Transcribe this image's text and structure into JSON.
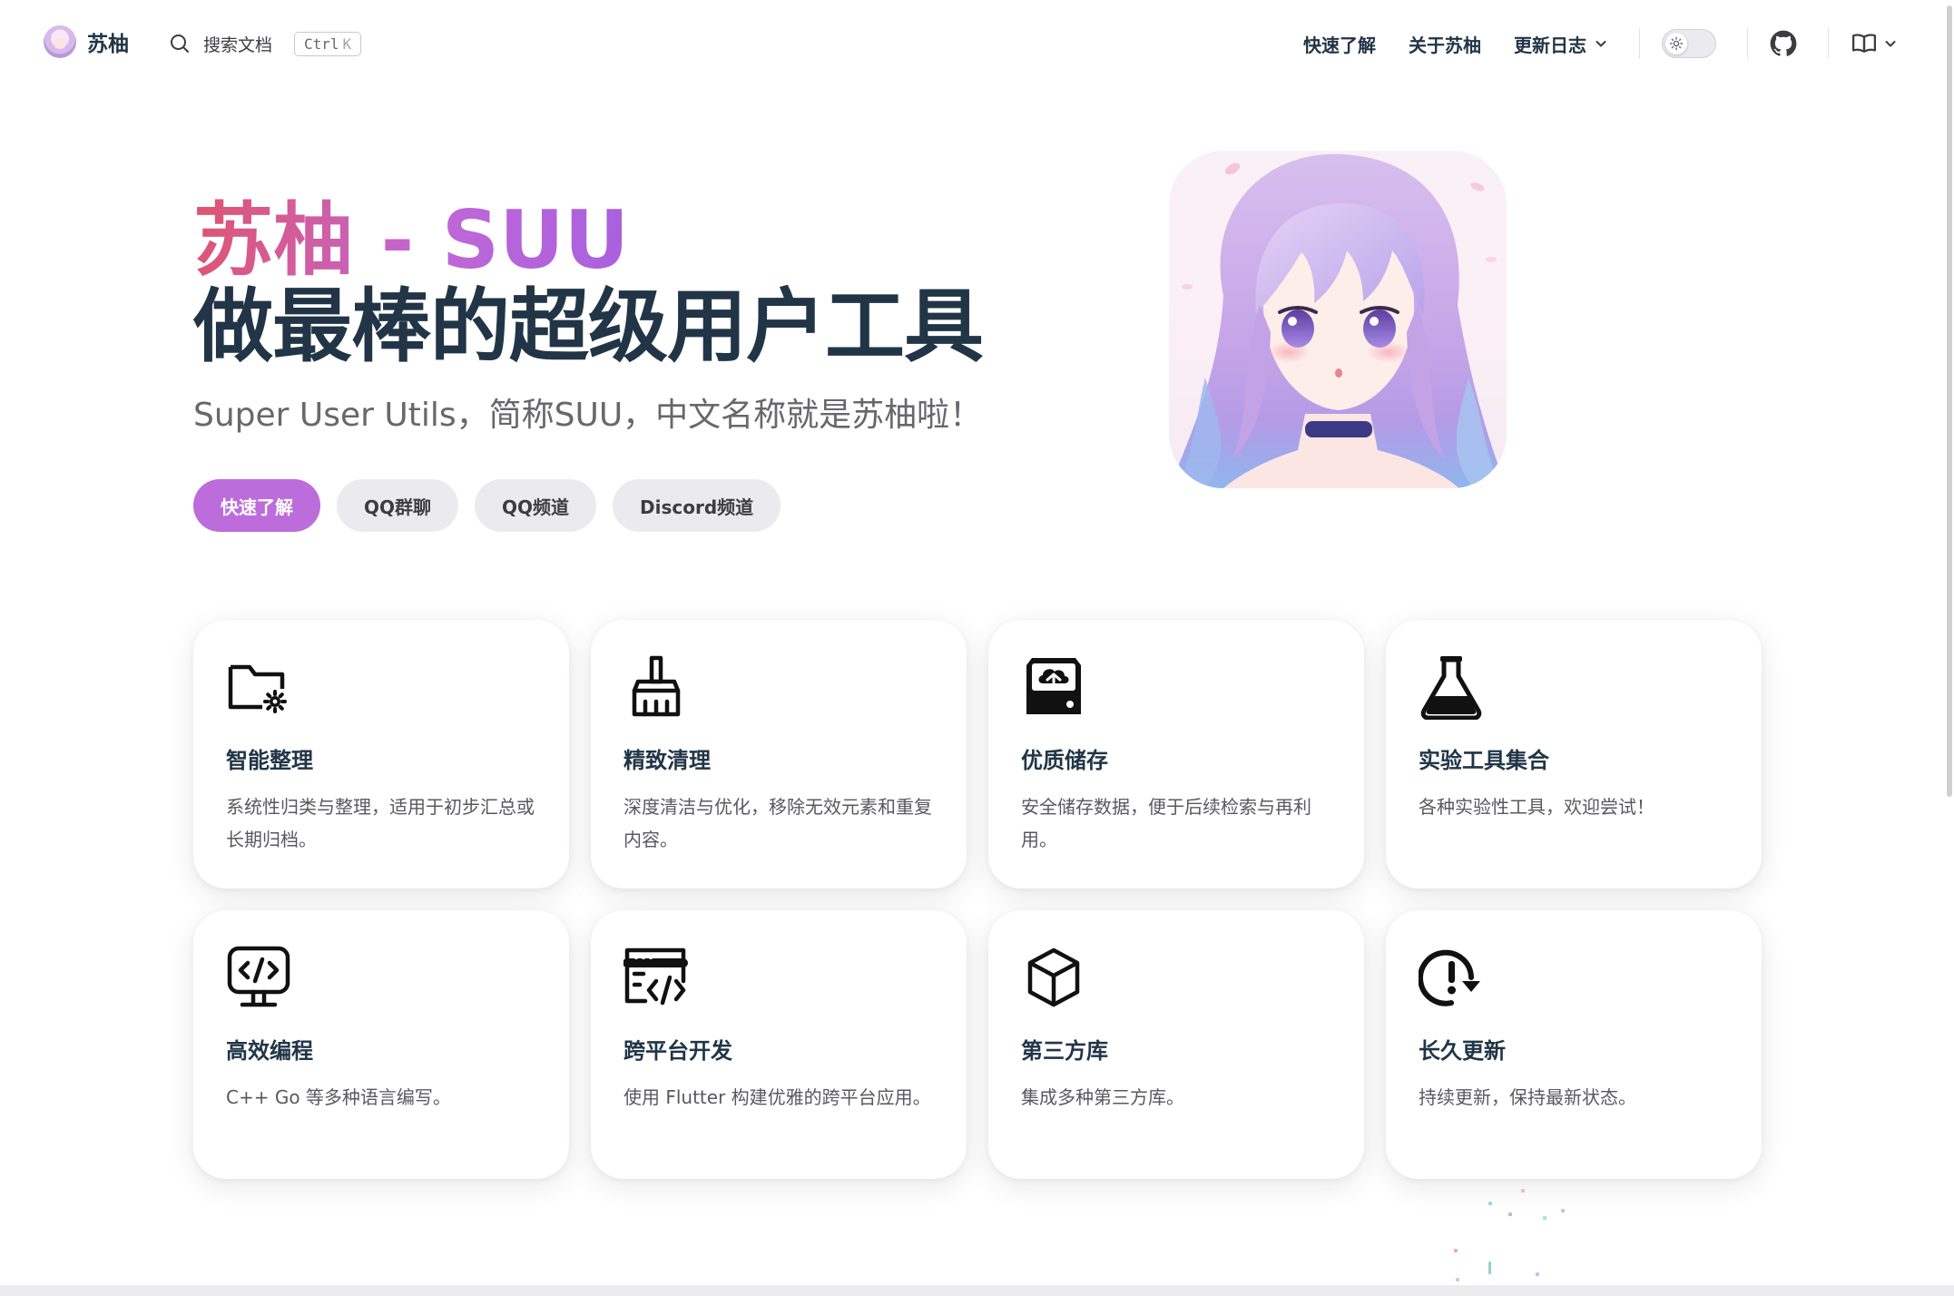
{
  "nav": {
    "brand": "苏柚",
    "search_label": "搜索文档",
    "search_key_ctrl": "Ctrl",
    "search_key_k": "K",
    "links": [
      {
        "label": "快速了解"
      },
      {
        "label": "关于苏柚"
      },
      {
        "label": "更新日志"
      }
    ]
  },
  "hero": {
    "name": "苏柚 - SUU",
    "text": "做最棒的超级用户工具",
    "tagline": "Super User Utils，简称SUU，中文名称就是苏柚啦！",
    "actions": [
      {
        "label": "快速了解",
        "theme": "brand"
      },
      {
        "label": "QQ群聊",
        "theme": "alt"
      },
      {
        "label": "QQ频道",
        "theme": "alt"
      },
      {
        "label": "Discord频道",
        "theme": "alt"
      }
    ]
  },
  "features": [
    {
      "icon": "folder-gear-icon",
      "title": "智能整理",
      "details": "系统性归类与整理，适用于初步汇总或长期归档。"
    },
    {
      "icon": "broom-icon",
      "title": "精致清理",
      "details": "深度清洁与优化，移除无效元素和重复内容。"
    },
    {
      "icon": "cloud-storage-icon",
      "title": "优质储存",
      "details": "安全储存数据，便于后续检索与再利用。"
    },
    {
      "icon": "flask-icon",
      "title": "实验工具集合",
      "details": "各种实验性工具，欢迎尝试！"
    },
    {
      "icon": "code-monitor-icon",
      "title": "高效编程",
      "details": "C++ Go 等多种语言编写。"
    },
    {
      "icon": "code-window-icon",
      "title": "跨平台开发",
      "details": "使用 Flutter 构建优雅的跨平台应用。"
    },
    {
      "icon": "cube-icon",
      "title": "第三方库",
      "details": "集成多种第三方库。"
    },
    {
      "icon": "update-alert-icon",
      "title": "长久更新",
      "details": "持续更新，保持最新状态。"
    }
  ],
  "colors": {
    "brand": "#bd6cdb",
    "text": "#213547",
    "name_gradient_start": "#e0546f",
    "name_gradient_end": "#a860e0"
  }
}
